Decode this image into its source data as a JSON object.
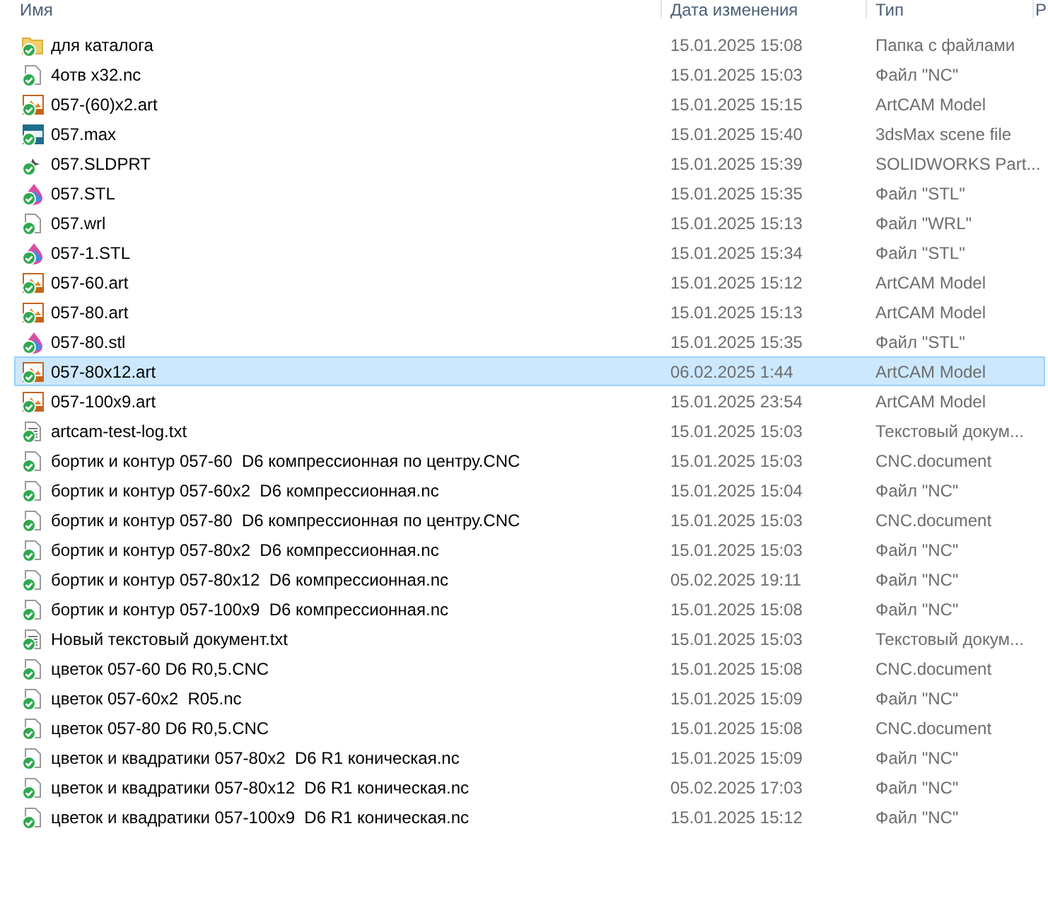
{
  "columns": [
    "Имя",
    "Дата изменения",
    "Тип",
    "Р"
  ],
  "files": [
    {
      "name": "для каталога",
      "date": "15.01.2025 15:08",
      "type": "Папка с файлами",
      "kind": "folder",
      "selected": false
    },
    {
      "name": "4отв x32.nc",
      "date": "15.01.2025 15:03",
      "type": "Файл \"NC\"",
      "kind": "doc",
      "selected": false
    },
    {
      "name": "057-(60)x2.art",
      "date": "15.01.2025 15:15",
      "type": "ArtCAM Model",
      "kind": "art",
      "selected": false
    },
    {
      "name": "057.max",
      "date": "15.01.2025 15:40",
      "type": "3dsMax scene file",
      "kind": "max",
      "selected": false
    },
    {
      "name": "057.SLDPRT",
      "date": "15.01.2025 15:39",
      "type": "SOLIDWORKS Part...",
      "kind": "sldprt",
      "selected": false
    },
    {
      "name": "057.STL",
      "date": "15.01.2025 15:35",
      "type": "Файл \"STL\"",
      "kind": "stl",
      "selected": false
    },
    {
      "name": "057.wrl",
      "date": "15.01.2025 15:13",
      "type": "Файл \"WRL\"",
      "kind": "doc",
      "selected": false
    },
    {
      "name": "057-1.STL",
      "date": "15.01.2025 15:34",
      "type": "Файл \"STL\"",
      "kind": "stl",
      "selected": false
    },
    {
      "name": "057-60.art",
      "date": "15.01.2025 15:12",
      "type": "ArtCAM Model",
      "kind": "art",
      "selected": false
    },
    {
      "name": "057-80.art",
      "date": "15.01.2025 15:13",
      "type": "ArtCAM Model",
      "kind": "art",
      "selected": false
    },
    {
      "name": "057-80.stl",
      "date": "15.01.2025 15:35",
      "type": "Файл \"STL\"",
      "kind": "stl",
      "selected": false
    },
    {
      "name": "057-80x12.art",
      "date": "06.02.2025 1:44",
      "type": "ArtCAM Model",
      "kind": "art",
      "selected": true
    },
    {
      "name": "057-100x9.art",
      "date": "15.01.2025 23:54",
      "type": "ArtCAM Model",
      "kind": "art",
      "selected": false
    },
    {
      "name": "artcam-test-log.txt",
      "date": "15.01.2025 15:03",
      "type": "Текстовый докум...",
      "kind": "txt",
      "selected": false
    },
    {
      "name": "бортик и контур 057-60  D6 компрессионная по центру.CNC",
      "date": "15.01.2025 15:03",
      "type": "CNC.document",
      "kind": "doc",
      "selected": false
    },
    {
      "name": "бортик и контур 057-60x2  D6 компрессионная.nc",
      "date": "15.01.2025 15:04",
      "type": "Файл \"NC\"",
      "kind": "doc",
      "selected": false
    },
    {
      "name": "бортик и контур 057-80  D6 компрессионная по центру.CNC",
      "date": "15.01.2025 15:03",
      "type": "CNC.document",
      "kind": "doc",
      "selected": false
    },
    {
      "name": "бортик и контур 057-80x2  D6 компрессионная.nc",
      "date": "15.01.2025 15:03",
      "type": "Файл \"NC\"",
      "kind": "doc",
      "selected": false
    },
    {
      "name": "бортик и контур 057-80x12  D6 компрессионная.nc",
      "date": "05.02.2025 19:11",
      "type": "Файл \"NC\"",
      "kind": "doc",
      "selected": false
    },
    {
      "name": "бортик и контур 057-100x9  D6 компрессионная.nc",
      "date": "15.01.2025 15:08",
      "type": "Файл \"NC\"",
      "kind": "doc",
      "selected": false
    },
    {
      "name": "Новый текстовый документ.txt",
      "date": "15.01.2025 15:03",
      "type": "Текстовый докум...",
      "kind": "txt",
      "selected": false
    },
    {
      "name": "цветок 057-60 D6 R0,5.CNC",
      "date": "15.01.2025 15:08",
      "type": "CNC.document",
      "kind": "doc",
      "selected": false
    },
    {
      "name": "цветок 057-60x2  R05.nc",
      "date": "15.01.2025 15:09",
      "type": "Файл \"NC\"",
      "kind": "doc",
      "selected": false
    },
    {
      "name": "цветок 057-80 D6 R0,5.CNC",
      "date": "15.01.2025 15:08",
      "type": "CNC.document",
      "kind": "doc",
      "selected": false
    },
    {
      "name": "цветок и квадратики 057-80x2  D6 R1 коническая.nc",
      "date": "15.01.2025 15:09",
      "type": "Файл \"NC\"",
      "kind": "doc",
      "selected": false
    },
    {
      "name": "цветок и квадратики 057-80x12  D6 R1 коническая.nc",
      "date": "05.02.2025 17:03",
      "type": "Файл \"NC\"",
      "kind": "doc",
      "selected": false
    },
    {
      "name": "цветок и квадратики 057-100x9  D6 R1 коническая.nc",
      "date": "15.01.2025 15:12",
      "type": "Файл \"NC\"",
      "kind": "doc",
      "selected": false
    }
  ]
}
